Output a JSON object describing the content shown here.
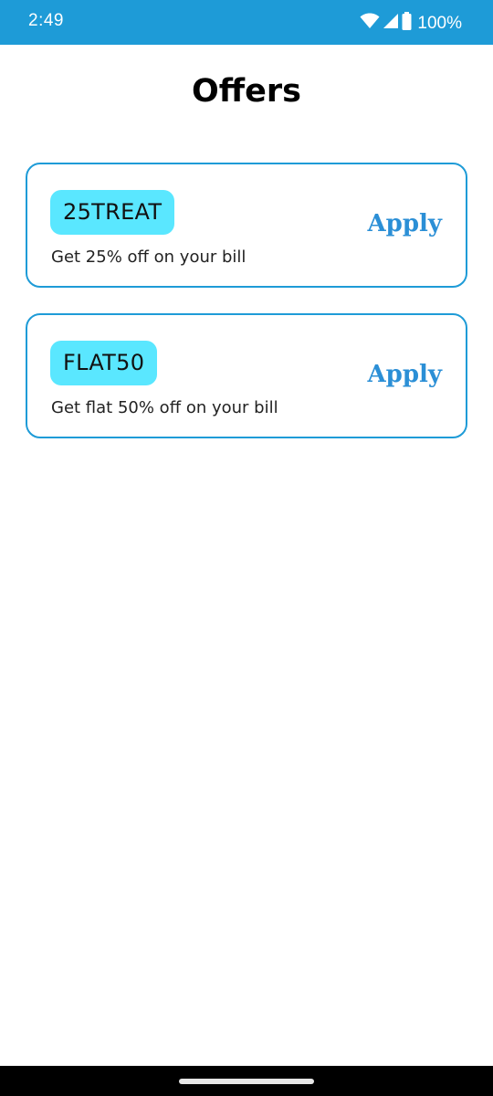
{
  "status_bar": {
    "time": "2:49",
    "battery": "100%",
    "icons": [
      "wifi-icon",
      "signal-icon",
      "battery-icon"
    ]
  },
  "page": {
    "title": "Offers"
  },
  "offers": [
    {
      "code": "25TREAT",
      "description": "Get 25% off on your bill",
      "action_label": "Apply"
    },
    {
      "code": "FLAT50",
      "description": "Get flat 50% off on your bill",
      "action_label": "Apply"
    }
  ],
  "colors": {
    "accent": "#1e9bd7",
    "code_chip": "#5ae7ff",
    "apply_text": "#2b8fd6"
  }
}
